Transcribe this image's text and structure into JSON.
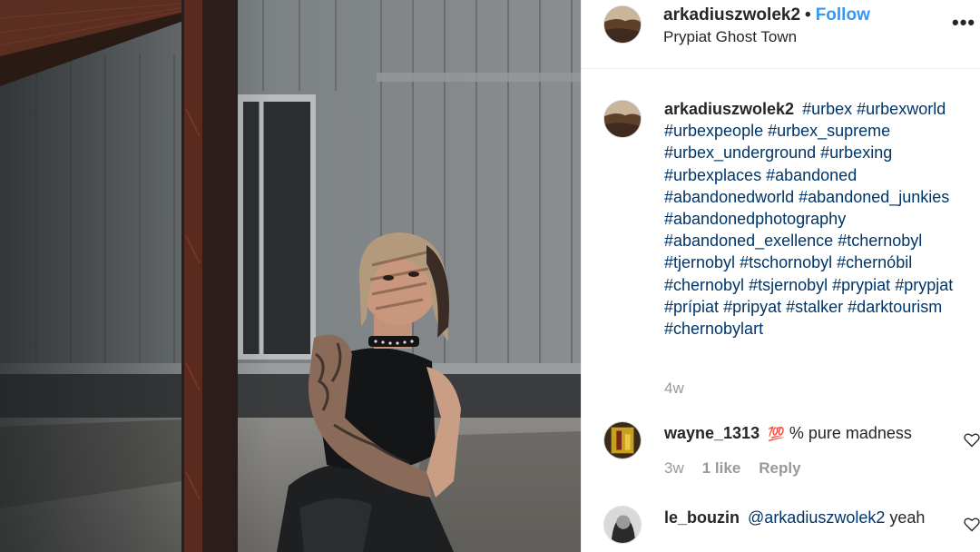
{
  "post": {
    "username": "arkadiuszwolek2",
    "dot": "•",
    "follow_label": "Follow",
    "location": "Prypiat Ghost Town",
    "more_label": "•••"
  },
  "caption": {
    "username": "arkadiuszwolek2",
    "hashtags": [
      "#urbex",
      "#urbexworld",
      "#urbexpeople",
      "#urbex_supreme",
      "#urbex_underground",
      "#urbexing",
      "#urbexplaces",
      "#abandoned",
      "#abandonedworld",
      "#abandoned_junkies",
      "#abandonedphotography",
      "#abandoned_exellence",
      "#tchernobyl",
      "#tjernobyl",
      "#tschornobyl",
      "#chernóbil",
      "#chernobyl",
      "#tsjernobyl",
      "#prypiat",
      "#prypjat",
      "#prípiat",
      "#pripyat",
      "#stalker",
      "#darktourism",
      "#chernobylart"
    ],
    "age": "4w"
  },
  "comments": [
    {
      "username": "wayne_1313",
      "emoji": "💯",
      "text": "% pure madness",
      "age": "3w",
      "likes": "1 like",
      "reply_label": "Reply"
    },
    {
      "username": "le_bouzin",
      "mention": "@arkadiuszwolek2",
      "text": "yeah"
    }
  ],
  "icons": {
    "more": "more-options-icon",
    "heart": "heart-outline-icon"
  },
  "colors": {
    "link_blue": "#3897f0",
    "hashtag_blue": "#003569",
    "muted_gray": "#999999",
    "text": "#262626",
    "divider": "#efefef"
  }
}
